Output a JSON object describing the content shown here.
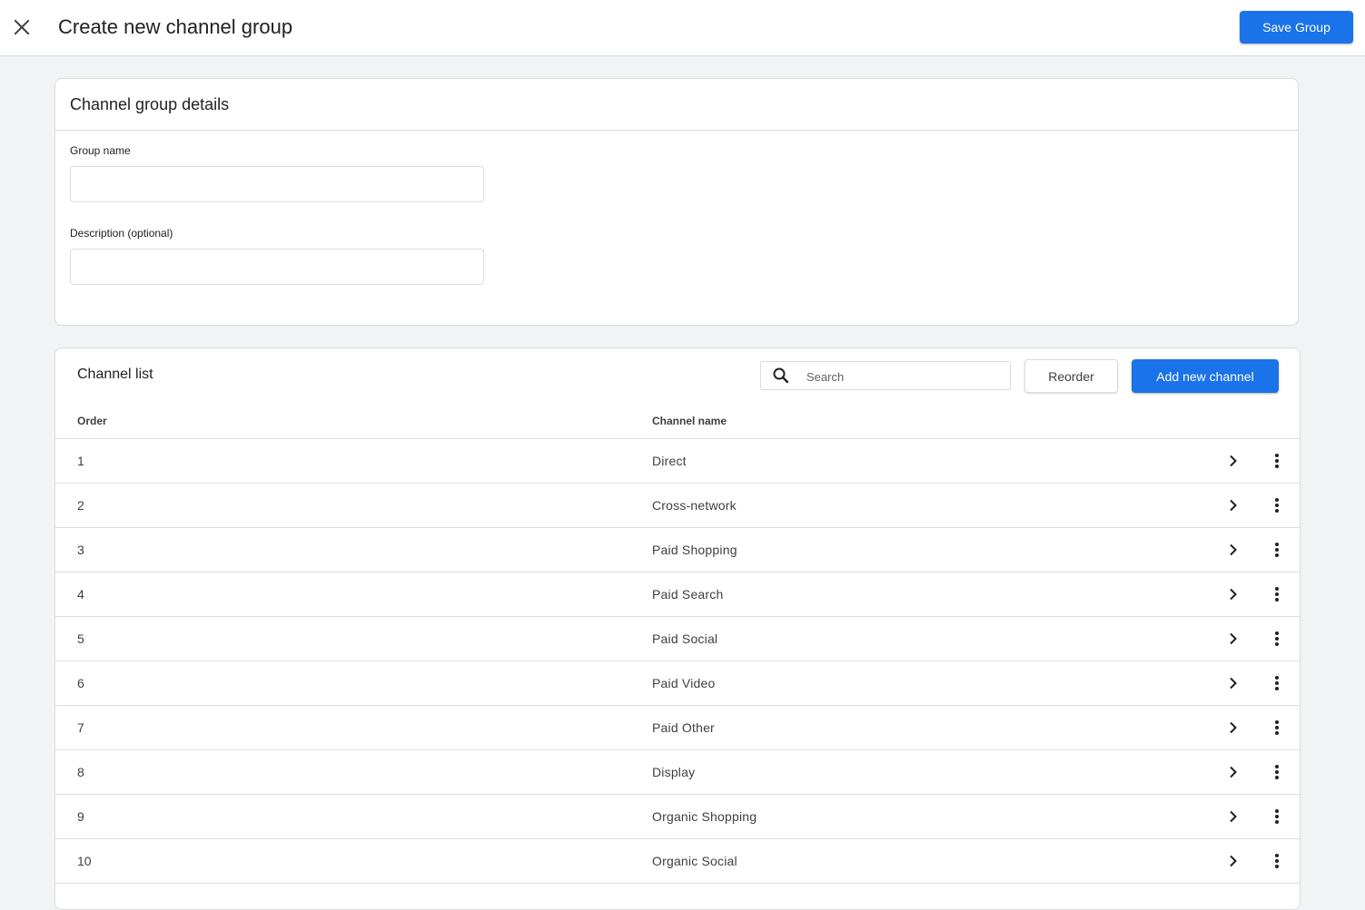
{
  "header": {
    "title": "Create new channel group",
    "close_icon": "close-icon",
    "save_label": "Save Group"
  },
  "details": {
    "title": "Channel group details",
    "group_name_label": "Group name",
    "group_name_value": "",
    "description_label": "Description (optional)",
    "description_value": ""
  },
  "channel_list": {
    "title": "Channel list",
    "search_placeholder": "Search",
    "search_icon": "search-icon",
    "reorder_label": "Reorder",
    "add_label": "Add new channel",
    "columns": {
      "order": "Order",
      "name": "Channel name"
    },
    "rows": [
      {
        "order": "1",
        "name": "Direct"
      },
      {
        "order": "2",
        "name": "Cross-network"
      },
      {
        "order": "3",
        "name": "Paid Shopping"
      },
      {
        "order": "4",
        "name": "Paid Search"
      },
      {
        "order": "5",
        "name": "Paid Social"
      },
      {
        "order": "6",
        "name": "Paid Video"
      },
      {
        "order": "7",
        "name": "Paid Other"
      },
      {
        "order": "8",
        "name": "Display"
      },
      {
        "order": "9",
        "name": "Organic Shopping"
      },
      {
        "order": "10",
        "name": "Organic Social"
      }
    ]
  },
  "colors": {
    "primary": "#1a73e8",
    "background": "#f1f3f4",
    "border": "#dadce0"
  }
}
